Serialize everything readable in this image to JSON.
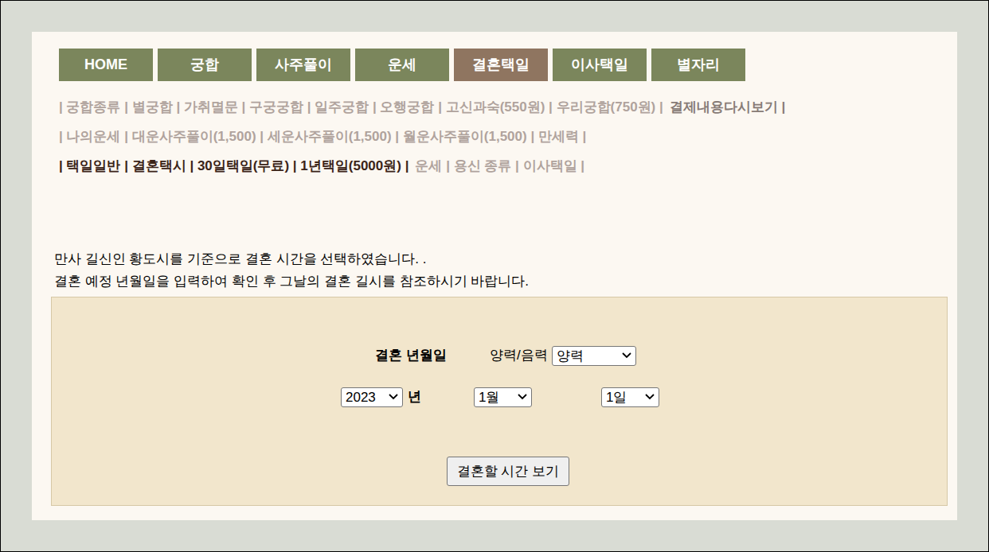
{
  "nav": [
    {
      "label": "HOME",
      "selected": false
    },
    {
      "label": "궁합",
      "selected": false
    },
    {
      "label": "사주풀이",
      "selected": false
    },
    {
      "label": "운세",
      "selected": false
    },
    {
      "label": "결혼택일",
      "selected": true
    },
    {
      "label": "이사택일",
      "selected": false
    },
    {
      "label": "별자리",
      "selected": false
    }
  ],
  "sub_links": [
    [
      {
        "text": "| 궁합종류 | 별궁합 | 가취멸문 | 구궁궁합 | 일주궁합 | 오행궁합 | 고신과숙(550원) | 우리궁합(750원) |",
        "tone": "muted"
      },
      {
        "text": "결제내용다시보기 |",
        "tone": "medium"
      }
    ],
    [
      {
        "text": "| 나의운세 | 대운사주풀이(1,500) | 세운사주풀이(1,500) | 월운사주풀이(1,500) | 만세력 |",
        "tone": "muted"
      }
    ],
    [
      {
        "text": "| 택일일반 | 결혼택시 | 30일택일(무료) | 1년택일(5000원) |",
        "tone": "strong"
      },
      {
        "text": "운세 | 용신 종류 | 이사택일 |",
        "tone": "muted"
      }
    ]
  ],
  "description": [
    "만사 길신인 황도시를 기준으로 결혼 시간을 선택하였습니다. .",
    "결혼 예정 년월일을 입력하여 확인 후 그날의 결혼 길시를 참조하시기 바랍니다."
  ],
  "form": {
    "title": "결혼 년월일",
    "calendar_label": "양력/음력",
    "calendar_value": "양력",
    "year": "2023",
    "year_suffix": "년",
    "month": "1월",
    "day": "1일",
    "button": "결혼할 시간 보기"
  }
}
